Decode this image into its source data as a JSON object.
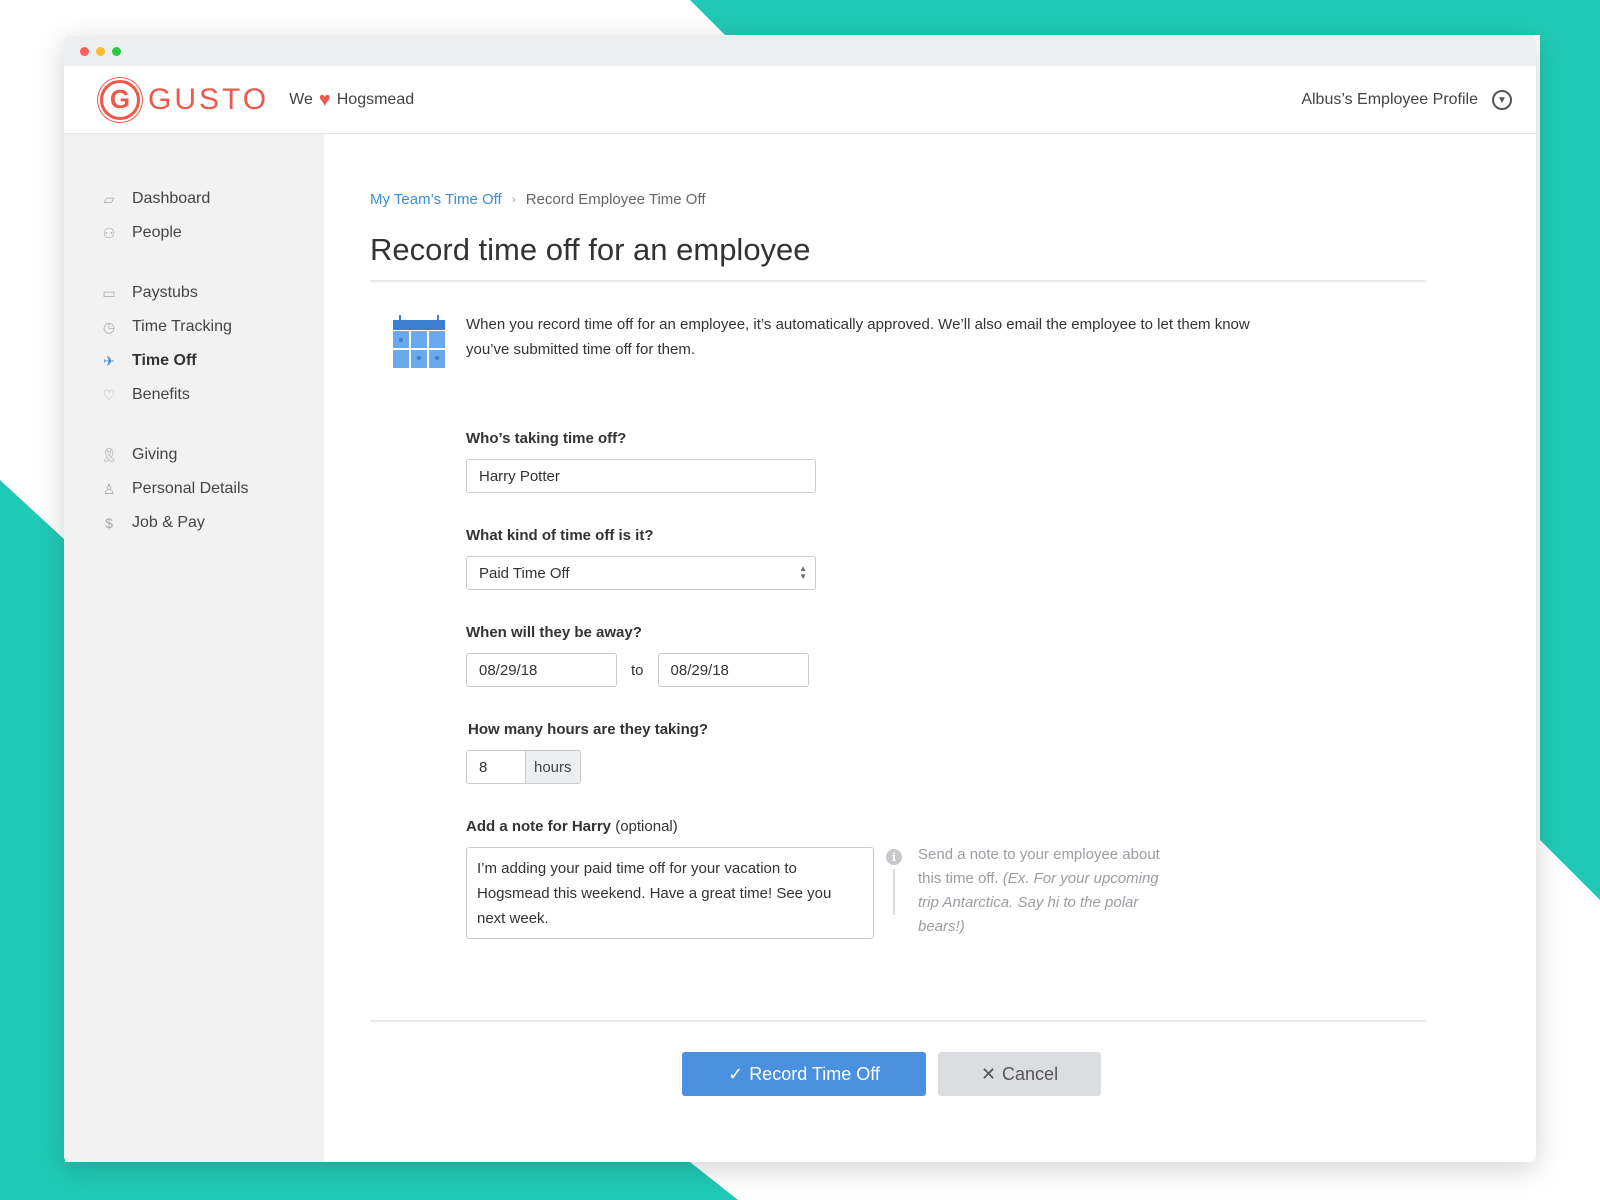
{
  "header": {
    "logo_letter": "G",
    "logo_text": "GUSTO",
    "tagline_before": "We",
    "tagline_after": "Hogsmead",
    "profile_label": "Albus’s Employee Profile"
  },
  "sidebar": {
    "groups": [
      [
        {
          "label": "Dashboard",
          "icon": "dashboard-icon"
        },
        {
          "label": "People",
          "icon": "people-icon"
        }
      ],
      [
        {
          "label": "Paystubs",
          "icon": "money-icon"
        },
        {
          "label": "Time Tracking",
          "icon": "clock-icon"
        },
        {
          "label": "Time Off",
          "icon": "plane-icon",
          "active": true
        },
        {
          "label": "Benefits",
          "icon": "heart-outline-icon"
        }
      ],
      [
        {
          "label": "Giving",
          "icon": "ribbon-icon"
        },
        {
          "label": "Personal Details",
          "icon": "person-icon"
        },
        {
          "label": "Job & Pay",
          "icon": "money-bag-icon"
        }
      ]
    ]
  },
  "breadcrumb": {
    "parent": "My Team’s Time Off",
    "current": "Record Employee Time Off"
  },
  "page": {
    "title": "Record time off for an employee",
    "info": "When you record time off for an employee, it’s automatically approved. We’ll also email the employee to let them know you’ve submitted time off for them."
  },
  "form": {
    "who_label": "Who’s taking time off?",
    "who_value": "Harry Potter",
    "kind_label": "What kind of time off is it?",
    "kind_value": "Paid Time Off",
    "when_label": "When will they be away?",
    "start_date": "08/29/18",
    "date_sep": "to",
    "end_date": "08/29/18",
    "hours_label": "How many hours are they taking?",
    "hours_value": "8",
    "hours_unit": "hours",
    "note_label": "Add a note for Harry",
    "note_optional": "(optional)",
    "note_value": "I’m adding your paid time off for your vacation to Hogsmead this weekend. Have a great time! See you next week.",
    "hint_text": "Send a note to your employee about this time off.",
    "hint_example": "(Ex. For your upcoming trip Antarctica. Say hi to the polar bears!)"
  },
  "actions": {
    "primary": "Record Time Off",
    "secondary": "Cancel"
  },
  "colors": {
    "brand": "#f0584c",
    "link": "#3a8fd9",
    "primary_button": "#4a90de",
    "background_accent": "#20c9b5"
  }
}
